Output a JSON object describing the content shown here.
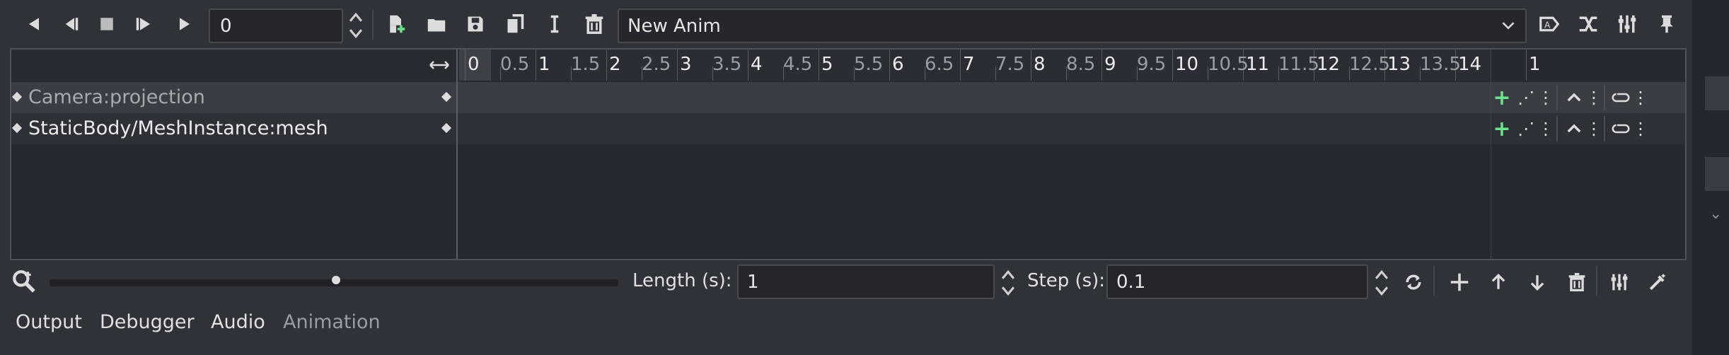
{
  "toolbar": {
    "frame_value": "0",
    "animation_name": "New Anim",
    "buttons": [
      "play-backwards-icon",
      "play-backwards-from-end-icon",
      "stop-icon",
      "play-from-start-icon",
      "play-icon",
      "new-animation-icon",
      "load-animation-icon",
      "save-animation-icon",
      "duplicate-animation-icon",
      "rename-animation-icon",
      "delete-animation-icon",
      "autoplay-on-load-icon",
      "blend-times-icon",
      "animation-settings-icon",
      "pin-icon"
    ]
  },
  "timeline": {
    "major_ticks": [
      "0",
      "1",
      "2",
      "3",
      "4",
      "5",
      "6",
      "7",
      "8",
      "9",
      "10",
      "11",
      "12",
      "13",
      "14",
      "1"
    ],
    "minor_ticks": [
      "0.5",
      "1.5",
      "2.5",
      "3.5",
      "4.5",
      "5.5",
      "6.5",
      "7.5",
      "8.5",
      "9.5",
      "10.5",
      "11.5",
      "12.5",
      "13.5"
    ]
  },
  "tracks": [
    {
      "name": "Camera:projection"
    },
    {
      "name": "StaticBody/MeshInstance:mesh"
    }
  ],
  "bottom": {
    "length_label": "Length (s):",
    "length_value": "1",
    "step_label": "Step (s):",
    "step_value": "0.1"
  },
  "dock_tabs": [
    {
      "label": "Output"
    },
    {
      "label": "Debugger"
    },
    {
      "label": "Audio"
    },
    {
      "label": "Animation"
    }
  ],
  "colors": {
    "panel": "#2f3239",
    "track_highlight": "#3a3d43",
    "insert_key_green": "#6be28a"
  }
}
